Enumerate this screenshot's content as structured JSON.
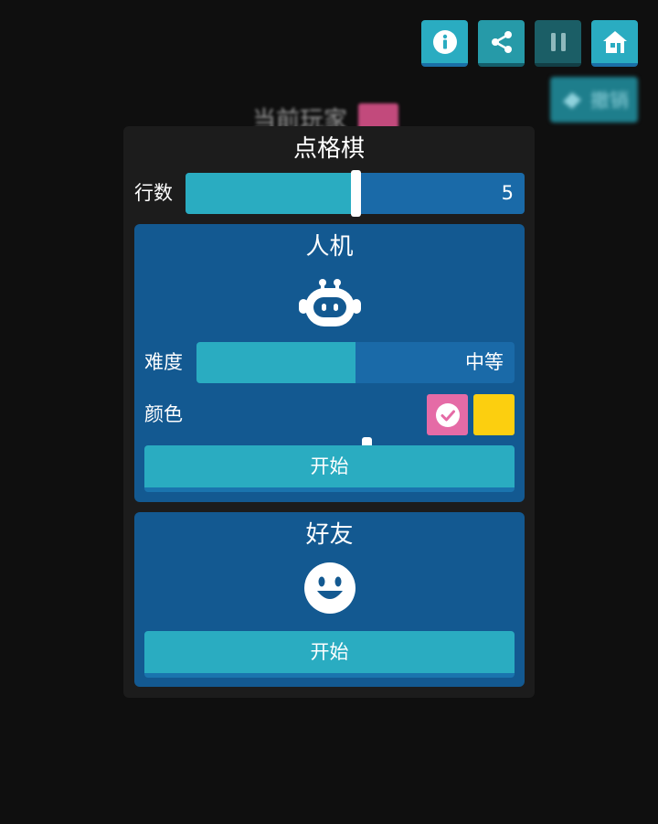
{
  "colors": {
    "accent": "#2aacc1",
    "slider_track": "#1a6aa8",
    "card_bg": "#135991",
    "panel_bg": "#1c1c1c",
    "pink": "#e56ba6",
    "yellow": "#fccf0f"
  },
  "toolbar": {
    "info_icon": "info-icon",
    "share_icon": "share-icon",
    "pause_icon": "pause-icon",
    "home_icon": "home-icon"
  },
  "background": {
    "undo_label": "撤销",
    "current_player_label": "当前玩家"
  },
  "panel": {
    "title": "点格棋",
    "rows": {
      "label": "行数",
      "value": "5",
      "fraction": 0.5
    }
  },
  "vs_computer": {
    "title": "人机",
    "icon": "robot-icon",
    "difficulty": {
      "label": "难度",
      "value": "中等",
      "fraction": 0.5
    },
    "color": {
      "label": "颜色",
      "options": [
        {
          "name": "pink",
          "hex": "#e56ba6",
          "selected": true
        },
        {
          "name": "yellow",
          "hex": "#fccf0f",
          "selected": false
        }
      ]
    },
    "start_label": "开始"
  },
  "vs_friend": {
    "title": "好友",
    "icon": "smiley-icon",
    "start_label": "开始"
  }
}
